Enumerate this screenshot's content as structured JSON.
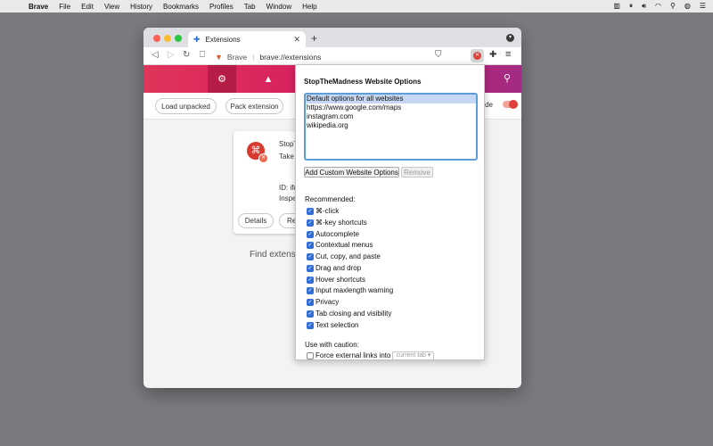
{
  "menubar": {
    "app": "Brave",
    "items": [
      "File",
      "Edit",
      "View",
      "History",
      "Bookmarks",
      "Profiles",
      "Tab",
      "Window",
      "Help"
    ]
  },
  "tab": {
    "title": "Extensions"
  },
  "omnibox": {
    "brand": "Brave",
    "url": "brave://extensions"
  },
  "devbar": {
    "load_unpacked": "Load unpacked",
    "pack_extension": "Pack extension",
    "devmode_label_fragment": "de"
  },
  "card": {
    "name_fragment": "StopT",
    "desc_fragment": "Take b",
    "id_fragment": "ID: ifd",
    "inspect_fragment": "Inspec",
    "details": "Details",
    "remove_fragment": "Re"
  },
  "find_fragment": "Find extensio",
  "popup": {
    "title": "StopTheMadness Website Options",
    "websites": [
      "Default options for all websites",
      "https://www.google.com/maps",
      "instagram.com",
      "wikipedia.org"
    ],
    "add_button": "Add Custom Website Options",
    "remove_button": "Remove",
    "recommended_label": "Recommended:",
    "recommended": [
      "⌘-click",
      "⌘-key shortcuts",
      "Autocomplete",
      "Contextual menus",
      "Cut, copy, and paste",
      "Drag and drop",
      "Hover shortcuts",
      "Input maxlength warning",
      "Privacy",
      "Tab closing and visibility",
      "Text selection"
    ],
    "caution_label": "Use with caution:",
    "force_links": "Force external links into",
    "force_links_select": "current tab"
  },
  "colors": {
    "accent": "#2f6fd6",
    "brand_red": "#e2413b"
  }
}
